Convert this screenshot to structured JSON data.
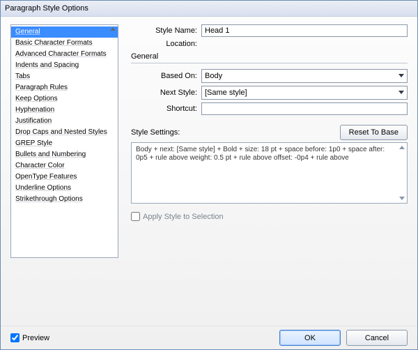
{
  "window": {
    "title": "Paragraph Style Options"
  },
  "sidebar": {
    "items": [
      "General",
      "Basic Character Formats",
      "Advanced Character Formats",
      "Indents and Spacing",
      "Tabs",
      "Paragraph Rules",
      "Keep Options",
      "Hyphenation",
      "Justification",
      "Drop Caps and Nested Styles",
      "GREP Style",
      "Bullets and Numbering",
      "Character Color",
      "OpenType Features",
      "Underline Options",
      "Strikethrough Options"
    ],
    "selected": 0
  },
  "fields": {
    "style_name_label": "Style Name:",
    "style_name_value": "Head 1",
    "location_label": "Location:",
    "section_title": "General",
    "based_on_label": "Based On:",
    "based_on_value": "Body",
    "next_style_label": "Next Style:",
    "next_style_value": "[Same style]",
    "shortcut_label": "Shortcut:",
    "shortcut_value": "",
    "settings_label": "Style Settings:",
    "reset_button": "Reset To Base",
    "settings_text": "Body + next: [Same style] + Bold + size: 18 pt + space before: 1p0 + space after: 0p5 + rule above weight: 0.5 pt + rule above offset: -0p4 + rule above",
    "apply_label": "Apply Style to Selection"
  },
  "footer": {
    "preview": "Preview",
    "preview_checked": true,
    "ok": "OK",
    "cancel": "Cancel"
  }
}
